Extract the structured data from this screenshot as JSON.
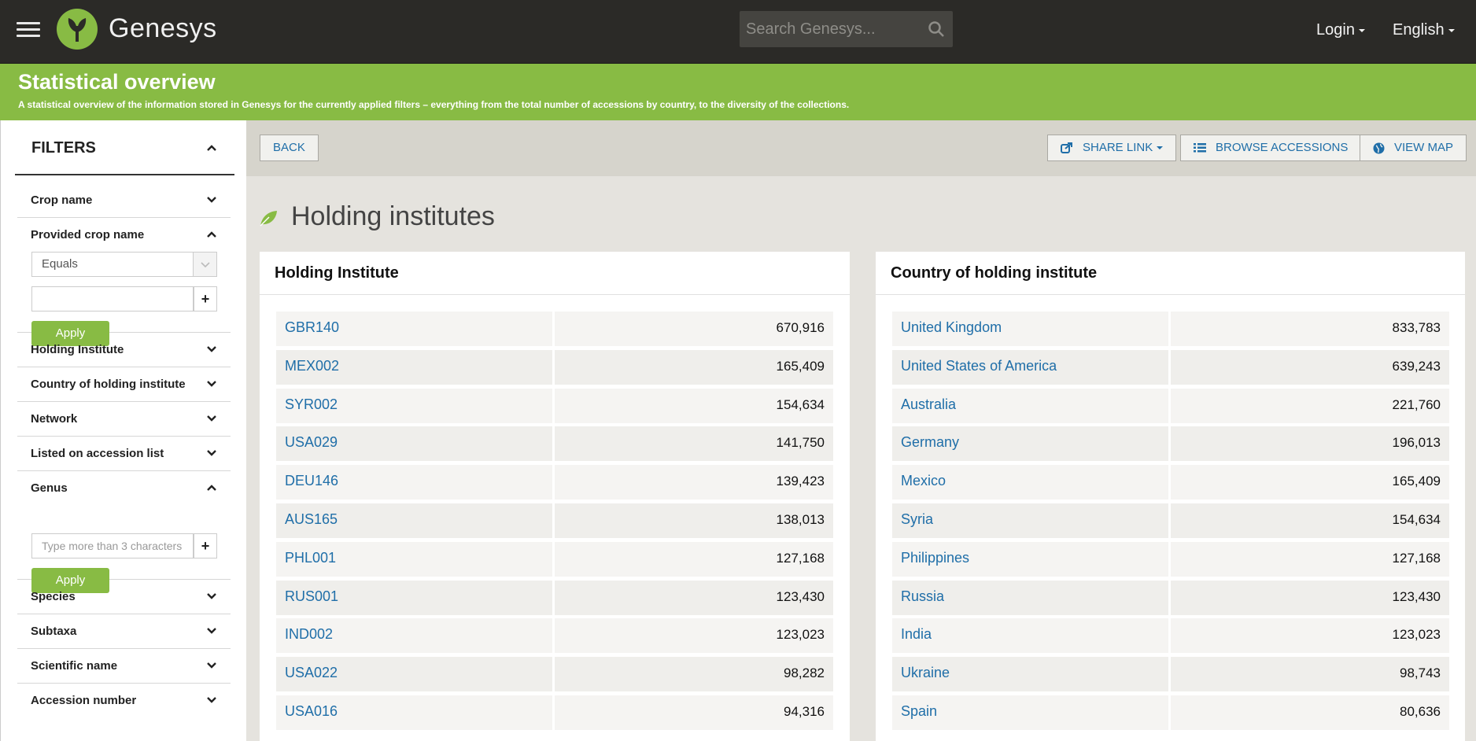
{
  "header": {
    "app_name": "Genesys",
    "search_placeholder": "Search Genesys...",
    "login_label": "Login",
    "language_label": "English"
  },
  "banner": {
    "title": "Statistical overview",
    "subtitle": "A statistical overview of the information stored in Genesys for the currently applied filters – everything from the total number of accessions by country, to the diversity of the collections."
  },
  "sidebar": {
    "title": "FILTERS",
    "filters": [
      {
        "label": "Crop name"
      },
      {
        "label": "Provided crop name",
        "select_value": "Equals",
        "apply_label": "Apply"
      },
      {
        "label": "Holding Institute"
      },
      {
        "label": "Country of holding institute"
      },
      {
        "label": "Network"
      },
      {
        "label": "Listed on accession list"
      },
      {
        "label": "Genus",
        "input_placeholder": "Type more than 3 characters",
        "apply_label": "Apply"
      },
      {
        "label": "Species"
      },
      {
        "label": "Subtaxa"
      },
      {
        "label": "Scientific name"
      },
      {
        "label": "Accession number"
      }
    ],
    "plus_label": "+"
  },
  "toolbar": {
    "back_label": "BACK",
    "share_label": "SHARE LINK",
    "browse_label": "BROWSE ACCESSIONS",
    "map_label": "VIEW MAP"
  },
  "main": {
    "section_title": "Holding institutes",
    "institutes": {
      "title": "Holding Institute",
      "rows": [
        {
          "name": "GBR140",
          "value": "670,916"
        },
        {
          "name": "MEX002",
          "value": "165,409"
        },
        {
          "name": "SYR002",
          "value": "154,634"
        },
        {
          "name": "USA029",
          "value": "141,750"
        },
        {
          "name": "DEU146",
          "value": "139,423"
        },
        {
          "name": "AUS165",
          "value": "138,013"
        },
        {
          "name": "PHL001",
          "value": "127,168"
        },
        {
          "name": "RUS001",
          "value": "123,430"
        },
        {
          "name": "IND002",
          "value": "123,023"
        },
        {
          "name": "USA022",
          "value": "98,282"
        },
        {
          "name": "USA016",
          "value": "94,316"
        }
      ]
    },
    "countries": {
      "title": "Country of holding institute",
      "rows": [
        {
          "name": "United Kingdom",
          "value": "833,783"
        },
        {
          "name": "United States of America",
          "value": "639,243"
        },
        {
          "name": "Australia",
          "value": "221,760"
        },
        {
          "name": "Germany",
          "value": "196,013"
        },
        {
          "name": "Mexico",
          "value": "165,409"
        },
        {
          "name": "Syria",
          "value": "154,634"
        },
        {
          "name": "Philippines",
          "value": "127,168"
        },
        {
          "name": "Russia",
          "value": "123,430"
        },
        {
          "name": "India",
          "value": "123,023"
        },
        {
          "name": "Ukraine",
          "value": "98,743"
        },
        {
          "name": "Spain",
          "value": "80,636"
        }
      ]
    }
  },
  "colors": {
    "brand_green": "#88bb44",
    "link_blue": "#1f6ea8",
    "topbar": "#2b2a27"
  }
}
